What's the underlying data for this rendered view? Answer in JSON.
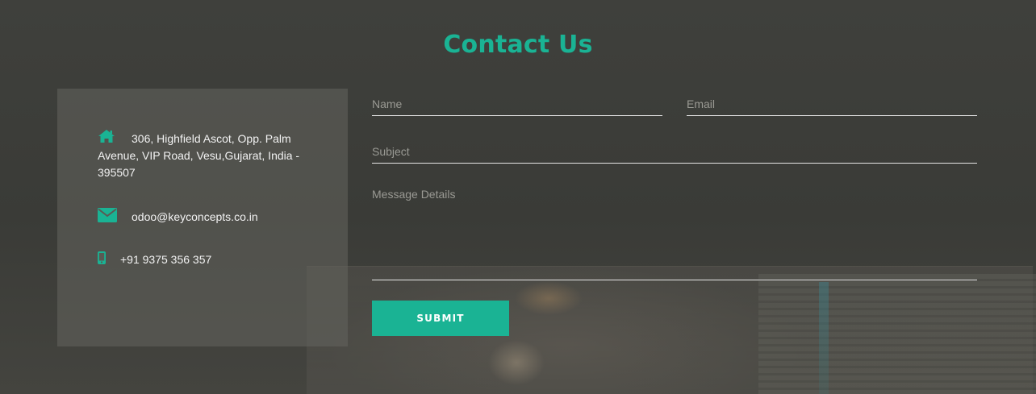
{
  "page": {
    "title": "Contact Us"
  },
  "colors": {
    "accent": "#1ab394",
    "panel": "#5a5a54",
    "text": "#f2f2f2"
  },
  "contact_info": {
    "address": {
      "icon": "home-icon",
      "text": "306, Highfield Ascot, Opp. Palm Avenue, VIP Road, Vesu,Gujarat, India - 395507"
    },
    "email": {
      "icon": "envelope-icon",
      "text": "odoo@keyconcepts.co.in"
    },
    "phone": {
      "icon": "mobile-phone-icon",
      "text": "+91 9375 356 357"
    }
  },
  "form": {
    "name_placeholder": "Name",
    "email_placeholder": "Email",
    "subject_placeholder": "Subject",
    "message_placeholder": "Message Details",
    "submit_label": "SUBMIT"
  }
}
